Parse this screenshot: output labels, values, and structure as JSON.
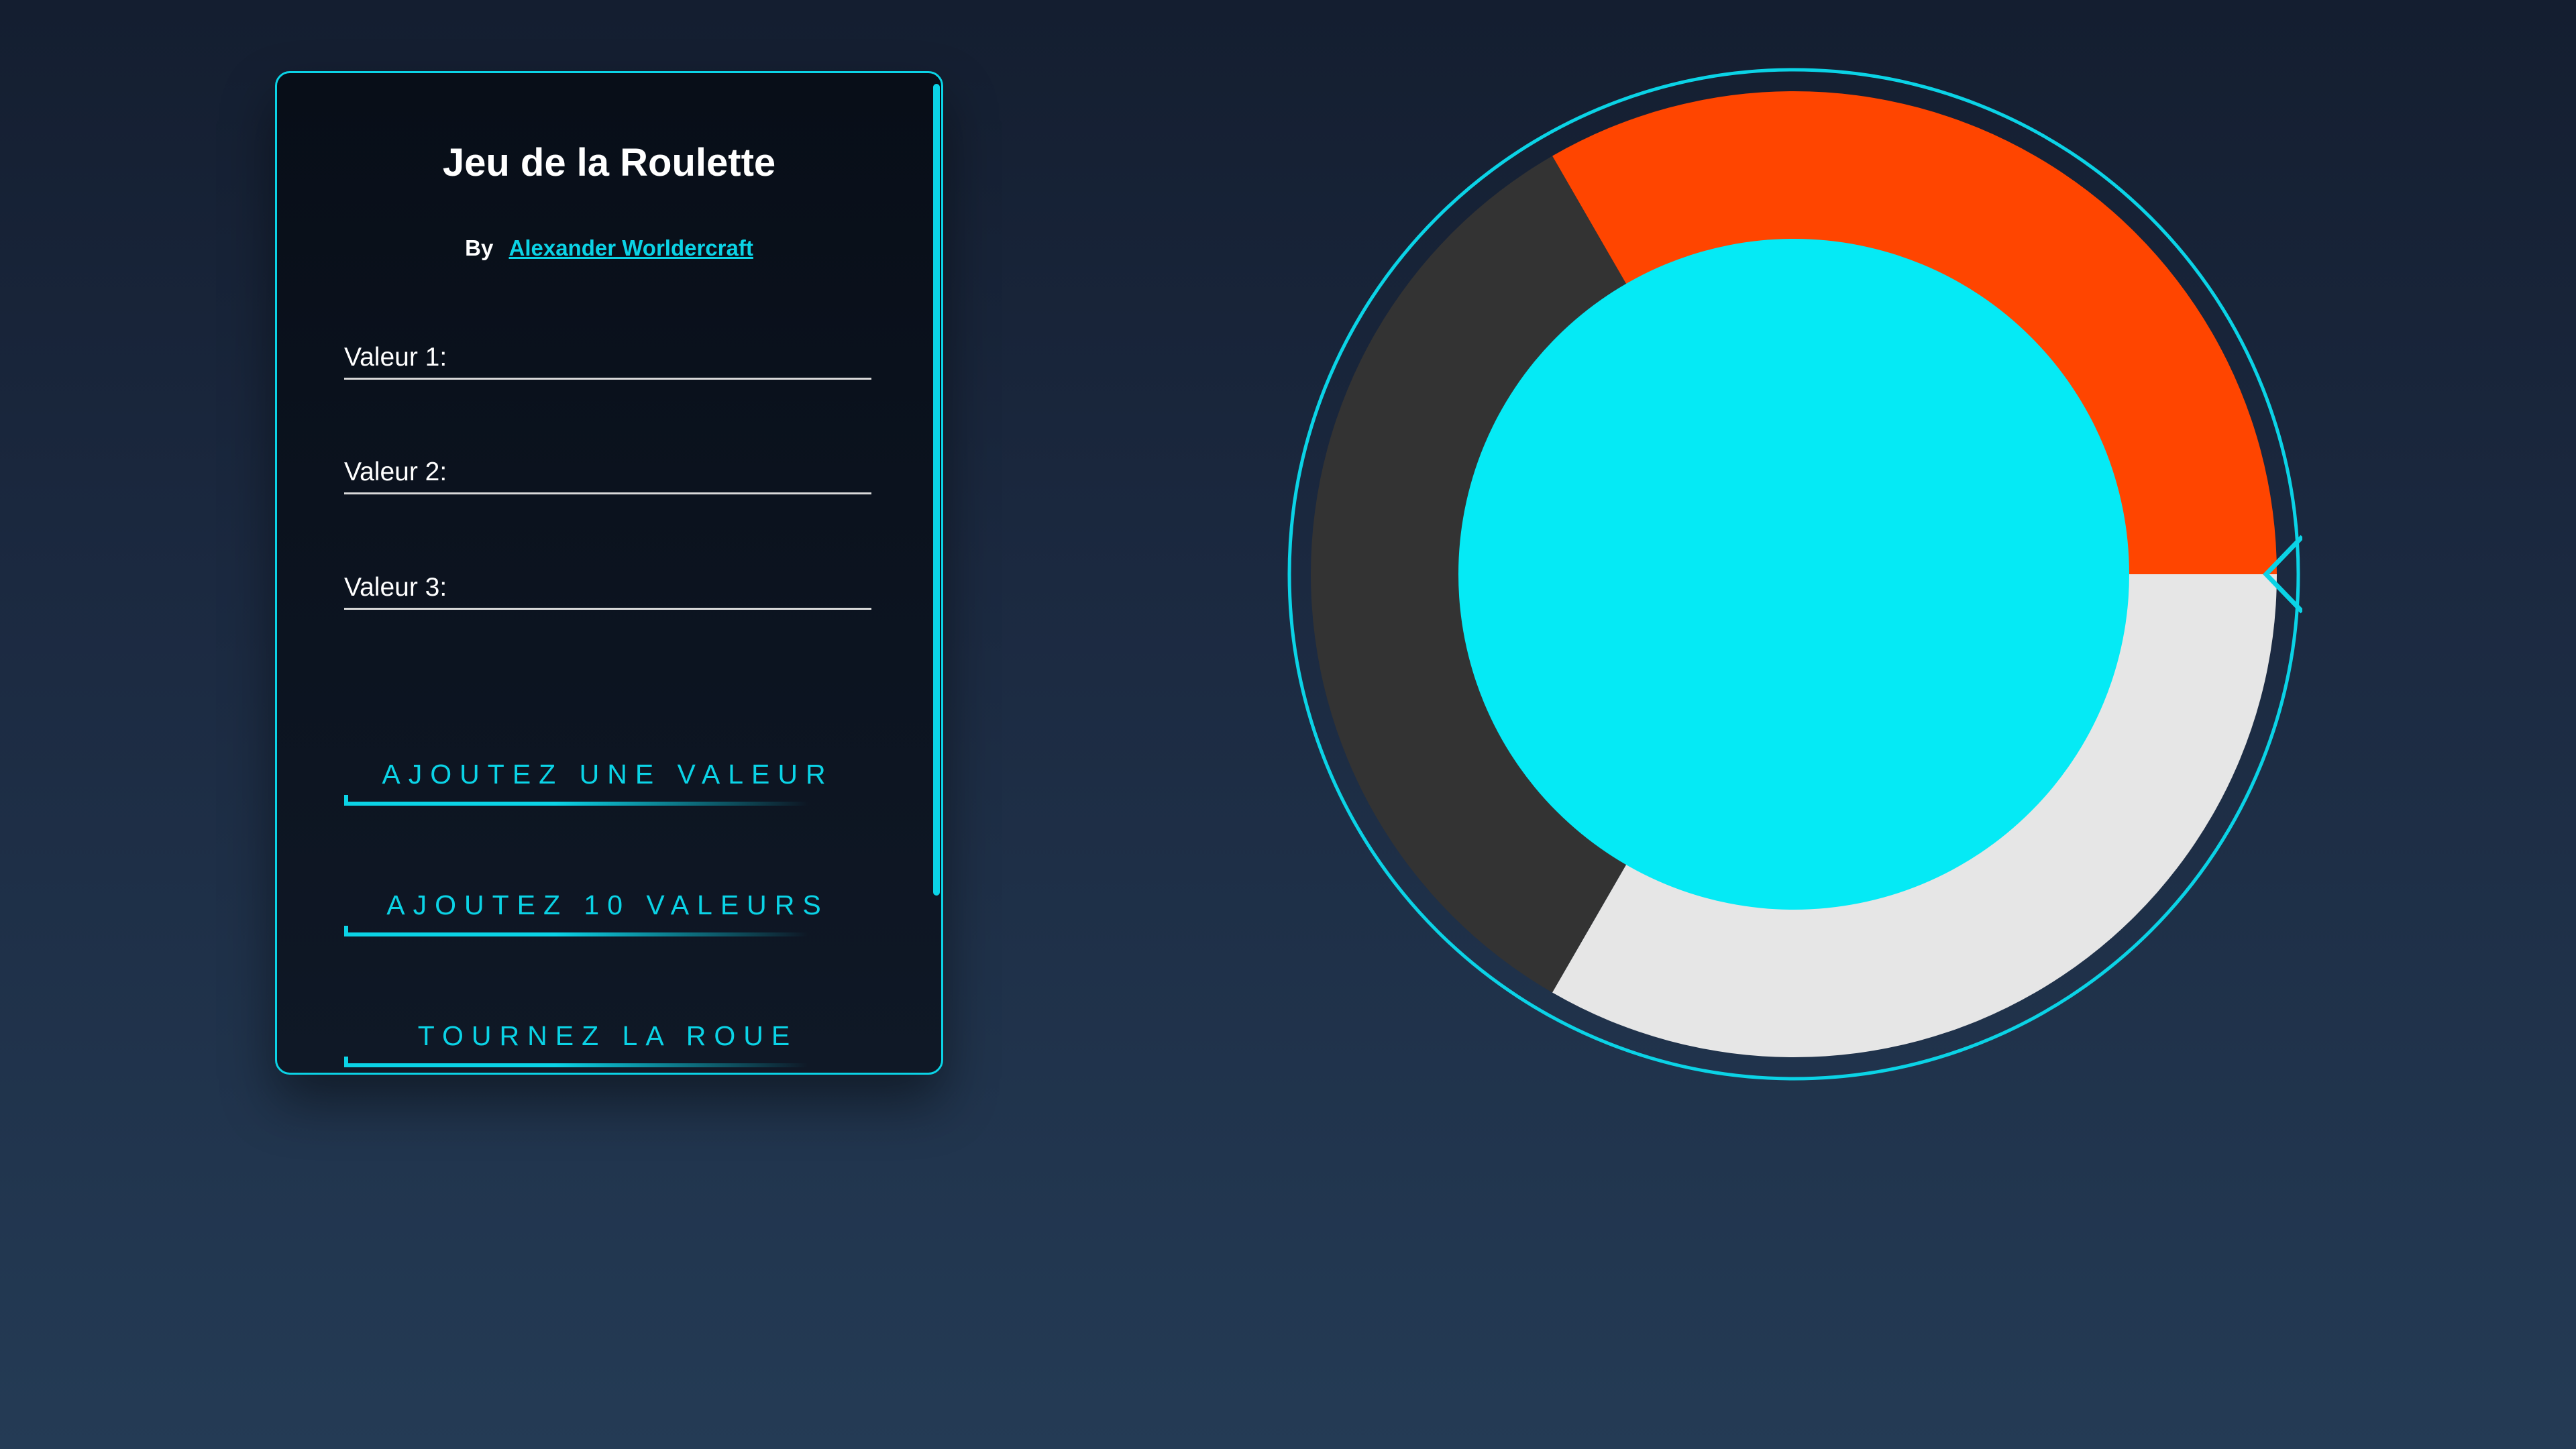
{
  "panel": {
    "title": "Jeu de la Roulette",
    "author_prefix": "By",
    "author_name": "Alexander Worldercraft",
    "fields": [
      {
        "label": "Valeur 1:",
        "value": ""
      },
      {
        "label": "Valeur 2:",
        "value": ""
      },
      {
        "label": "Valeur 3:",
        "value": ""
      }
    ],
    "buttons": {
      "add_one": "AJOUTEZ UNE VALEUR",
      "add_ten": "AJOUTEZ 10 VALEURS",
      "spin": "TOURNEZ LA ROUE"
    }
  },
  "wheel": {
    "segments": [
      {
        "color": "#ff4500",
        "start_deg": -120,
        "end_deg": 0
      },
      {
        "color": "#e6e6e6",
        "start_deg": 0,
        "end_deg": 120
      },
      {
        "color": "#333333",
        "start_deg": 120,
        "end_deg": 240
      }
    ],
    "hub_color": "#05eaf5",
    "ring_color": "#0bd3e6",
    "pointer_icon": "pointer-triangle-icon"
  },
  "colors": {
    "accent": "#0bd3e6",
    "panel_background": "#0b121e",
    "text": "#ffffff"
  }
}
